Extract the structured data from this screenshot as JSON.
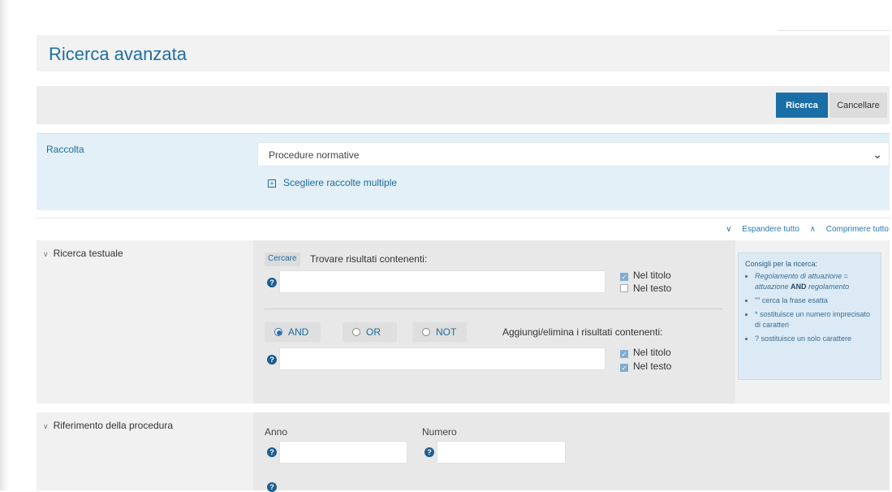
{
  "page_title": "Ricerca avanzata",
  "actions": {
    "search_label": "Ricerca",
    "cancel_label": "Cancellare"
  },
  "raccolta": {
    "label": "Raccolta",
    "selected": "Procedure normative",
    "multi_link": "Scegliere raccolte multiple"
  },
  "expand": {
    "expand_all": "Espandere tutto",
    "collapse_all": "Comprimere tutto"
  },
  "text_search": {
    "section_label": "Ricerca testuale",
    "cercare_tag": "Cercare",
    "find_label": "Trovare risultati contenenti:",
    "first_checks": [
      {
        "label": "Nel titolo",
        "checked": true
      },
      {
        "label": "Nel testo",
        "checked": false
      }
    ],
    "operators": [
      {
        "label": "AND",
        "selected": true
      },
      {
        "label": "OR",
        "selected": false
      },
      {
        "label": "NOT",
        "selected": false
      }
    ],
    "add_remove_label": "Aggiungi/elimina i risultati contenenti:",
    "second_checks": [
      {
        "label": "Nel titolo",
        "checked": true
      },
      {
        "label": "Nel testo",
        "checked": true
      }
    ]
  },
  "tips": {
    "title": "Consigli per la ricerca:",
    "items": [
      {
        "lead": "Regolamento di attuazione",
        "eq": " = ",
        "a": "attuazione ",
        "op": "AND",
        "b": " regolamento"
      },
      {
        "text": "\"\" cerca la frase esatta"
      },
      {
        "text": "* sostituisce un numero imprecisato di caratteri"
      },
      {
        "text": "? sostituisce un solo carattere"
      }
    ]
  },
  "procedure_ref": {
    "section_label": "Riferimento della procedura",
    "year_label": "Anno",
    "number_label": "Numero"
  },
  "colors": {
    "accent": "#1a6ea6",
    "panel_blue": "#e4f0f7",
    "title_blue": "#1f6ea0"
  }
}
